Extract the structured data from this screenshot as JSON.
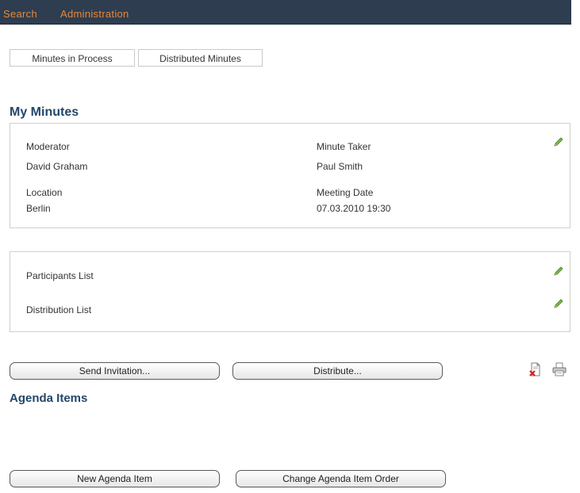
{
  "nav": {
    "search": "Search",
    "administration": "Administration"
  },
  "tabs": [
    "Minutes in Process",
    "Distributed Minutes"
  ],
  "page_title": "My Minutes",
  "meeting": {
    "moderator_label": "Moderator",
    "moderator_value": "David Graham",
    "minute_taker_label": "Minute Taker",
    "minute_taker_value": "Paul Smith",
    "location_label": "Location",
    "location_value": "Berlin",
    "meeting_date_label": "Meeting Date",
    "meeting_date_value": "07.03.2010 19:30"
  },
  "lists": {
    "participants": "Participants List",
    "distribution": "Distribution List"
  },
  "actions": {
    "send_invitation": "Send Invitation...",
    "distribute": "Distribute..."
  },
  "agenda": {
    "title": "Agenda Items",
    "new_item": "New Agenda Item",
    "change_order": "Change Agenda Item Order"
  },
  "icons": {
    "edit": "pencil-icon",
    "pdf": "pdf-delete-icon",
    "print": "printer-icon"
  },
  "colors": {
    "topbar": "#2e3d4f",
    "nav_link": "#e8883a",
    "heading": "#24466b"
  }
}
